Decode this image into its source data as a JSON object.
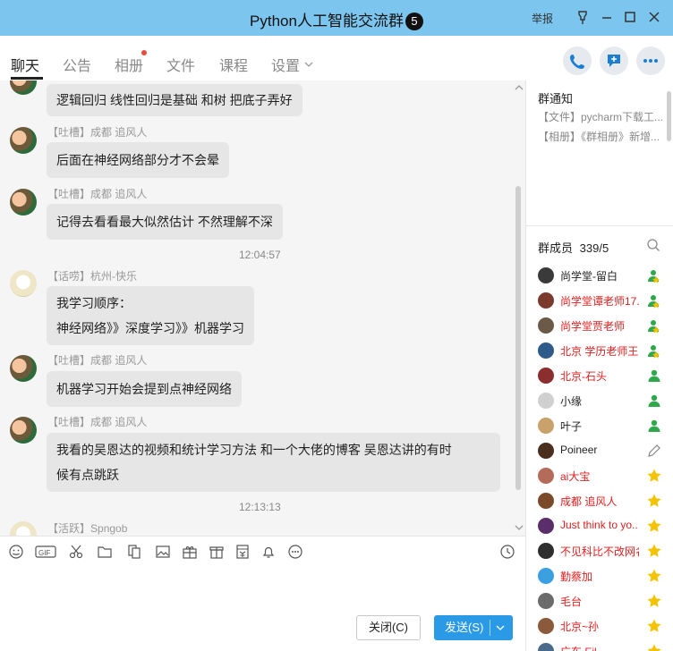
{
  "window": {
    "title": "Python人工智能交流群",
    "title_badge": "5",
    "report_label": "举报"
  },
  "tabs": [
    {
      "label": "聊天"
    },
    {
      "label": "公告"
    },
    {
      "label": "相册"
    },
    {
      "label": "文件"
    },
    {
      "label": "课程"
    },
    {
      "label": "设置"
    }
  ],
  "tab_icons": [
    "phone-icon",
    "chat-bubble-icon",
    "more-icon"
  ],
  "messages": [
    {
      "tag": "",
      "sender": "",
      "lines": [
        "逻辑回归 线性回归是基础  和树  把底子弄好"
      ]
    },
    {
      "tag": "【吐槽】",
      "sender": "成都 追风人",
      "lines": [
        "后面在神经网络部分才不会晕"
      ]
    },
    {
      "tag": "【吐槽】",
      "sender": "成都 追风人",
      "lines": [
        "记得去看看最大似然估计  不然理解不深"
      ]
    },
    {
      "tag": "【话唠】",
      "sender": "杭州-快乐",
      "lines": [
        "我学习顺序：",
        "神经网络》》深度学习》》机器学习"
      ]
    },
    {
      "tag": "【吐槽】",
      "sender": "成都 追风人",
      "lines": [
        "机器学习开始会提到点神经网络"
      ]
    },
    {
      "tag": "【吐槽】",
      "sender": "成都 追风人",
      "lines": [
        "我看的吴恩达的视频和统计学习方法  和一个大佬的博客  吴恩达讲的有时",
        "候有点跳跃"
      ]
    },
    {
      "tag": "【活跃】",
      "sender": "Spngob",
      "lines": []
    }
  ],
  "timestamps": [
    "12:04:57",
    "12:13:13"
  ],
  "toolbar_icons": [
    "emoji-icon",
    "gif-icon",
    "scissors-icon",
    "folder-icon",
    "file-transfer-icon",
    "image-icon",
    "gift-box-icon",
    "gift-icon",
    "red-packet-icon",
    "bell-icon",
    "more-circle-icon",
    "history-clock-icon"
  ],
  "buttons": {
    "close": "关闭(C)",
    "send": "发送(S)"
  },
  "notice": {
    "title": "群通知",
    "items": [
      "【文件】pycharm下载工...",
      "【相册】《群相册》新增..."
    ]
  },
  "members": {
    "title": "群成员",
    "count": "339/5",
    "list": [
      {
        "name": "尚学堂-留白",
        "color": "#222222",
        "badge": "admin"
      },
      {
        "name": "尚学堂谭老师17...",
        "color": "#e02020",
        "badge": "admin"
      },
      {
        "name": "尚学堂贾老师",
        "color": "#e02020",
        "badge": "admin"
      },
      {
        "name": "北京 学历老师王...",
        "color": "#e02020",
        "badge": "admin"
      },
      {
        "name": "北京-石头",
        "color": "#e02020",
        "badge": "member"
      },
      {
        "name": "小缘",
        "color": "#222222",
        "badge": "member"
      },
      {
        "name": "叶子",
        "color": "#222222",
        "badge": "member"
      },
      {
        "name": "Poineer",
        "color": "#222222",
        "badge": "edit"
      },
      {
        "name": "ai大宝",
        "color": "#e02020",
        "badge": "star"
      },
      {
        "name": "成都 追风人",
        "color": "#e02020",
        "badge": "star"
      },
      {
        "name": "Just think to yo...",
        "color": "#e02020",
        "badge": "star"
      },
      {
        "name": "不见科比不改网名...",
        "color": "#e02020",
        "badge": "star"
      },
      {
        "name": "勤蔡加",
        "color": "#e02020",
        "badge": "star"
      },
      {
        "name": "毛台",
        "color": "#e02020",
        "badge": "star"
      },
      {
        "name": "北京~孙",
        "color": "#e02020",
        "badge": "star"
      },
      {
        "name": "广东 Eil",
        "color": "#e02020",
        "badge": "star"
      }
    ]
  }
}
